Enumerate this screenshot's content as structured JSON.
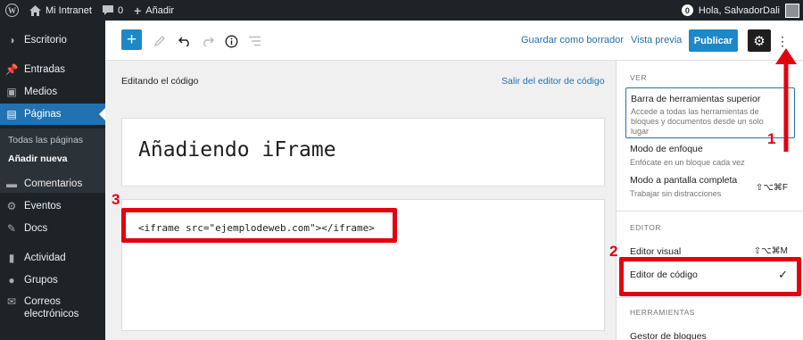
{
  "admin_bar": {
    "site_name": "Mi Intranet",
    "comments_count": "0",
    "new_label": "Añadir",
    "notifications_count": "0",
    "greeting": "Hola, SalvadorDali"
  },
  "sidebar": {
    "items": [
      {
        "label": "Escritorio",
        "icon": "dashboard-icon"
      },
      {
        "label": "Entradas",
        "icon": "pin-icon"
      },
      {
        "label": "Medios",
        "icon": "media-icon"
      },
      {
        "label": "Páginas",
        "icon": "pages-icon"
      },
      {
        "label": "Comentarios",
        "icon": "comment-icon"
      },
      {
        "label": "Eventos",
        "icon": "events-icon"
      },
      {
        "label": "Docs",
        "icon": "docs-icon"
      },
      {
        "label": "Actividad",
        "icon": "activity-icon"
      },
      {
        "label": "Grupos",
        "icon": "groups-icon"
      },
      {
        "label": "Correos electrónicos",
        "icon": "email-icon"
      }
    ],
    "submenu": [
      "Todas las páginas",
      "Añadir nueva"
    ]
  },
  "header": {
    "save_draft_label": "Guardar como borrador",
    "preview_label": "Vista previa",
    "publish_label": "Publicar"
  },
  "editor": {
    "mode_label": "Editando el código",
    "exit_label": "Salir del editor de código",
    "title": "Añadiendo iFrame",
    "code": "<iframe src=\"ejemplodeweb.com\"></iframe>"
  },
  "panel": {
    "section_view": "VER",
    "top_toolbar_label": "Barra de herramientas superior",
    "top_toolbar_desc": "Accede a todas las herramientas de bloques y documentos desde un solo lugar",
    "focus_label": "Modo de enfoque",
    "focus_desc": "Enfócate en un bloque cada vez",
    "fullscreen_label": "Modo a pantalla completa",
    "fullscreen_desc": "Trabajar sin distracciones",
    "fullscreen_shortcut": "⇧⌥⌘F",
    "section_editor": "EDITOR",
    "visual_editor_label": "Editor visual",
    "visual_editor_shortcut": "⇧⌥⌘M",
    "code_editor_label": "Editor de código",
    "code_editor_check": "✓",
    "section_tools": "HERRAMIENTAS",
    "block_manager_label": "Gestor de bloques"
  },
  "annotations": {
    "one": "1",
    "two": "2",
    "three": "3"
  },
  "colors": {
    "admin_dark": "#1d2327",
    "accent_blue": "#2271b1",
    "annotation_red": "#e3000f"
  }
}
